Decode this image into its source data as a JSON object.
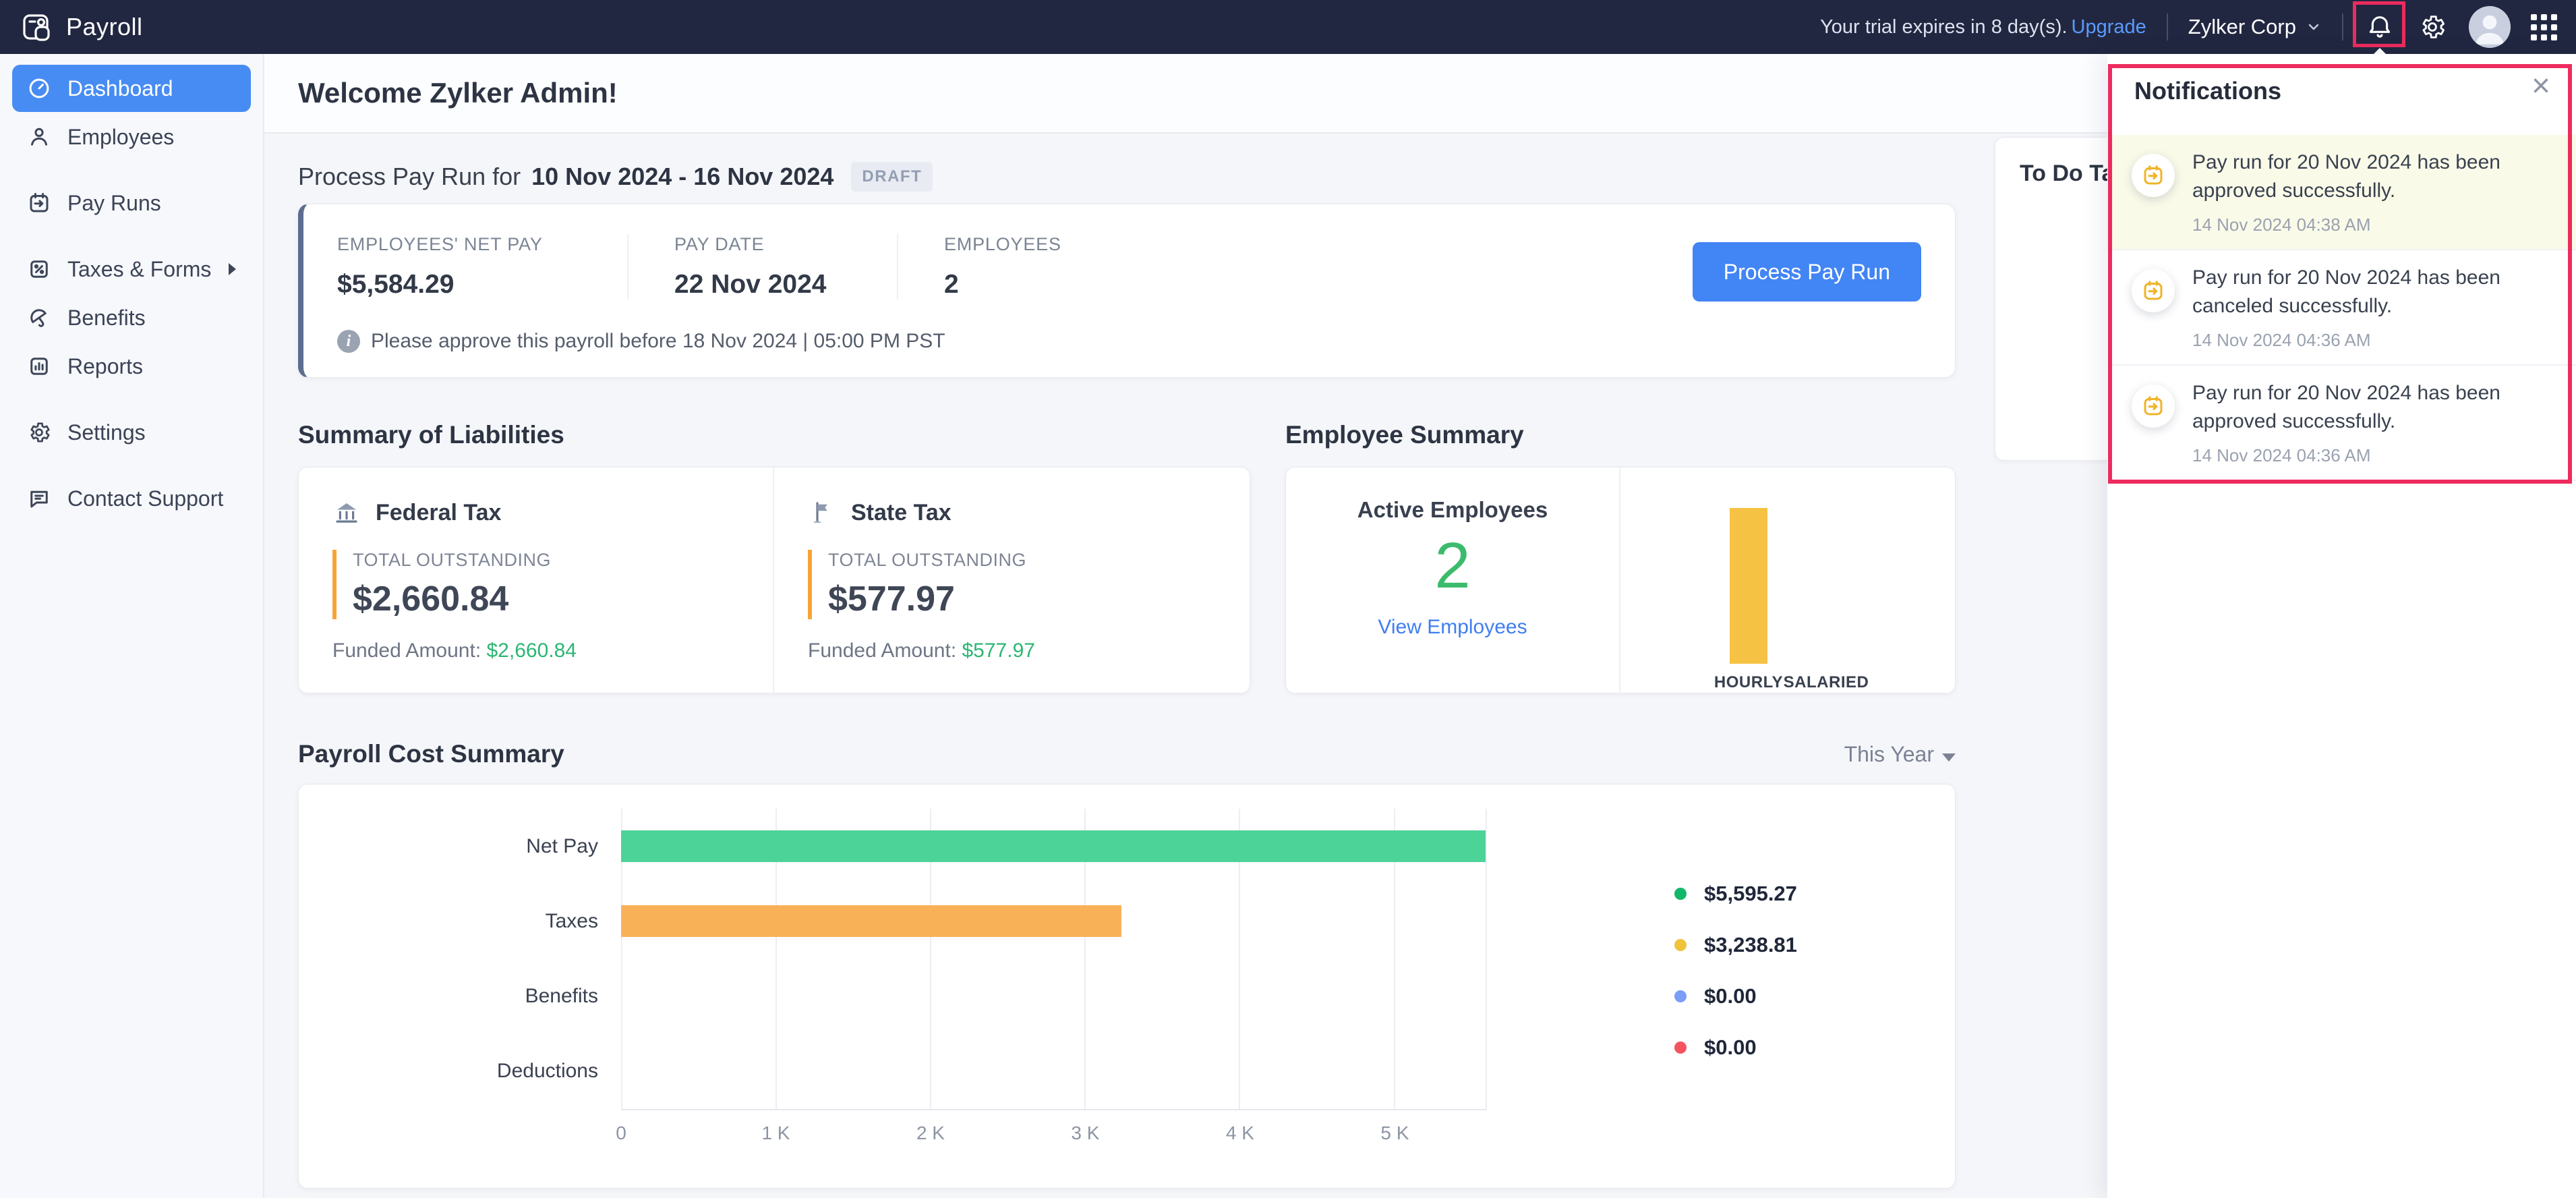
{
  "topbar": {
    "app_name": "Payroll",
    "trial_text": "Your trial expires in 8 day(s).",
    "upgrade_label": "Upgrade",
    "org_name": "Zylker Corp"
  },
  "sidebar": {
    "items": [
      {
        "label": "Dashboard",
        "icon": "dashboard-icon",
        "active": true
      },
      {
        "label": "Employees",
        "icon": "employees-icon",
        "active": false
      },
      {
        "label": "Pay Runs",
        "icon": "pay-runs-icon",
        "active": false
      },
      {
        "label": "Taxes & Forms",
        "icon": "taxes-forms-icon",
        "active": false,
        "has_submenu": true
      },
      {
        "label": "Benefits",
        "icon": "benefits-icon",
        "active": false
      },
      {
        "label": "Reports",
        "icon": "reports-icon",
        "active": false
      },
      {
        "label": "Settings",
        "icon": "settings-icon",
        "active": false
      },
      {
        "label": "Contact Support",
        "icon": "contact-support-icon",
        "active": false
      }
    ]
  },
  "main": {
    "welcome_title": "Welcome Zylker Admin!",
    "payrun": {
      "title_prefix": "Process Pay Run for",
      "period": "10 Nov 2024 - 16 Nov 2024",
      "status_badge": "DRAFT",
      "stats": [
        {
          "label": "EMPLOYEES' NET PAY",
          "value": "$5,584.29"
        },
        {
          "label": "PAY DATE",
          "value": "22 Nov 2024"
        },
        {
          "label": "EMPLOYEES",
          "value": "2"
        }
      ],
      "process_button_label": "Process Pay Run",
      "approval_note": "Please approve this payroll before 18 Nov 2024 | 05:00 PM PST"
    },
    "liabilities": {
      "title": "Summary of Liabilities",
      "cards": [
        {
          "name": "Federal Tax",
          "outstanding_label": "TOTAL OUTSTANDING",
          "outstanding": "$2,660.84",
          "funded_label": "Funded Amount:",
          "funded": "$2,660.84"
        },
        {
          "name": "State Tax",
          "outstanding_label": "TOTAL OUTSTANDING",
          "outstanding": "$577.97",
          "funded_label": "Funded Amount:",
          "funded": "$577.97"
        }
      ]
    },
    "employee_summary": {
      "title": "Employee Summary",
      "active_label": "Active Employees",
      "active_count": "2",
      "view_link": "View Employees"
    },
    "payroll_cost": {
      "title": "Payroll Cost Summary",
      "range_selector": "This Year"
    },
    "todo_panel": {
      "visible_title": "To Do Ta"
    }
  },
  "chart_data": [
    {
      "id": "employee-type",
      "type": "bar",
      "orientation": "vertical",
      "title": "Employee Summary",
      "categories": [
        "HOURLY",
        "SALARIED"
      ],
      "values": [
        2,
        0
      ],
      "bar_color": "#f6c244",
      "ylim": [
        0,
        2
      ],
      "grid": false,
      "legend_position": "none"
    },
    {
      "id": "payroll-cost",
      "type": "bar",
      "orientation": "horizontal",
      "title": "Payroll Cost Summary",
      "period": "This Year",
      "categories": [
        "Net Pay",
        "Taxes",
        "Benefits",
        "Deductions"
      ],
      "values": [
        5595.27,
        3238.81,
        0,
        0
      ],
      "value_labels": [
        "$5,595.27",
        "$3,238.81",
        "$0.00",
        "$0.00"
      ],
      "bar_colors": [
        "#4cd398",
        "#f9b158",
        "#7b9ef7",
        "#f5545f"
      ],
      "legend_dot_colors": [
        "#12b76a",
        "#f0c33c",
        "#7b9ef7",
        "#f5545f"
      ],
      "xticks": [
        0,
        1000,
        2000,
        3000,
        4000,
        5000
      ],
      "xtick_labels": [
        "0",
        "1 K",
        "2 K",
        "3 K",
        "4 K",
        "5 K"
      ],
      "xlim": [
        0,
        5595.27
      ],
      "grid": "vertical",
      "legend_position": "right"
    }
  ],
  "notifications": {
    "title": "Notifications",
    "close_glyph": "×",
    "items": [
      {
        "text": "Pay run for 20 Nov 2024 has been approved successfully.",
        "time": "14 Nov 2024 04:38 AM",
        "highlighted": true
      },
      {
        "text": "Pay run for 20 Nov 2024 has been canceled successfully.",
        "time": "14 Nov 2024 04:36 AM",
        "highlighted": false
      },
      {
        "text": "Pay run for 20 Nov 2024 has been approved successfully.",
        "time": "14 Nov 2024 04:36 AM",
        "highlighted": false
      }
    ]
  },
  "colors": {
    "topbar_bg": "#222741",
    "active_nav_blue": "#478cf3",
    "primary_button_blue": "#4285f4",
    "annotation_pink": "#ed2b5e",
    "positive_green": "#2bb673",
    "outstanding_accent_orange": "#f7a437",
    "link_blue": "#3f7ef0",
    "notification_highlight_bg": "#fafae9"
  }
}
